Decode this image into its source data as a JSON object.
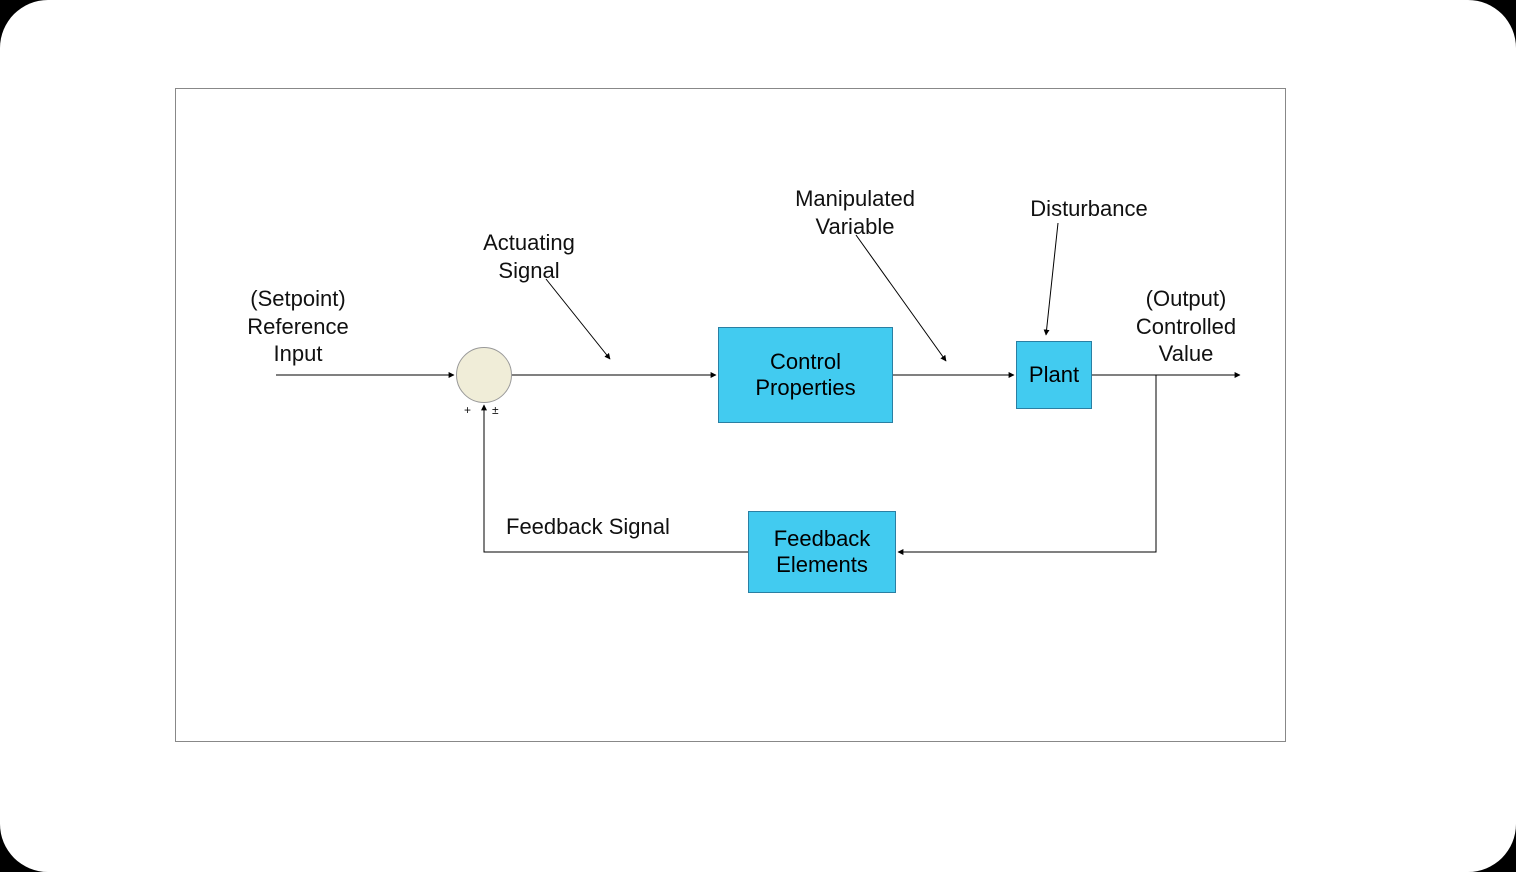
{
  "labels": {
    "setpoint_line1": "(Setpoint)",
    "setpoint_line2": "Reference",
    "setpoint_line3": "Input",
    "actuating_line1": "Actuating",
    "actuating_line2": "Signal",
    "manipulated_line1": "Manipulated",
    "manipulated_line2": "Variable",
    "disturbance": "Disturbance",
    "output_line1": "(Output)",
    "output_line2": "Controlled",
    "output_line3": "Value",
    "feedback_signal": "Feedback Signal",
    "plus": "+",
    "plusminus": "±"
  },
  "blocks": {
    "control_line1": "Control",
    "control_line2": "Properties",
    "plant": "Plant",
    "feedback_line1": "Feedback",
    "feedback_line2": "Elements"
  }
}
